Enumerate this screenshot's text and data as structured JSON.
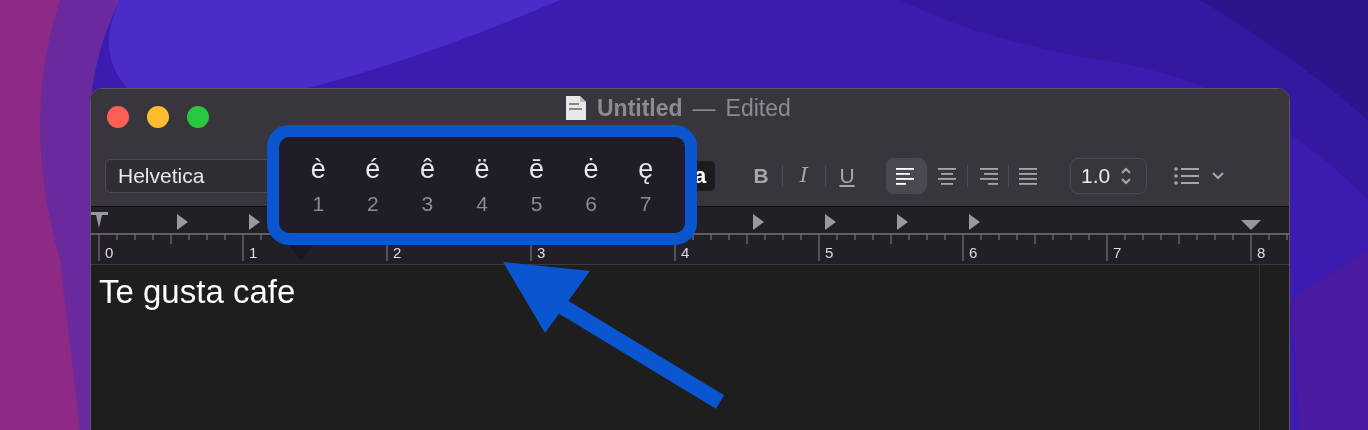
{
  "window": {
    "title": "Untitled",
    "separator": "—",
    "subtitle": "Edited"
  },
  "toolbar": {
    "font": "Helvetica",
    "color_well": "a",
    "styles": [
      {
        "kind": "bold",
        "label": "B"
      },
      {
        "kind": "italic",
        "label": "I"
      },
      {
        "kind": "underline",
        "label": "U"
      }
    ],
    "alignment": [
      {
        "kind": "left",
        "selected": true
      },
      {
        "kind": "center",
        "selected": false
      },
      {
        "kind": "right",
        "selected": false
      },
      {
        "kind": "justify",
        "selected": false
      }
    ],
    "line_spacing": "1.0"
  },
  "ruler": {
    "labels": [
      "0",
      "1",
      "2",
      "3",
      "4",
      "5",
      "6",
      "7",
      "8"
    ]
  },
  "document": {
    "text": "Te gusta cafe"
  },
  "accent_popover": {
    "options": [
      {
        "char": "è",
        "key": "1"
      },
      {
        "char": "é",
        "key": "2"
      },
      {
        "char": "ê",
        "key": "3"
      },
      {
        "char": "ë",
        "key": "4"
      },
      {
        "char": "ē",
        "key": "5"
      },
      {
        "char": "ė",
        "key": "6"
      },
      {
        "char": "ę",
        "key": "7"
      }
    ]
  }
}
